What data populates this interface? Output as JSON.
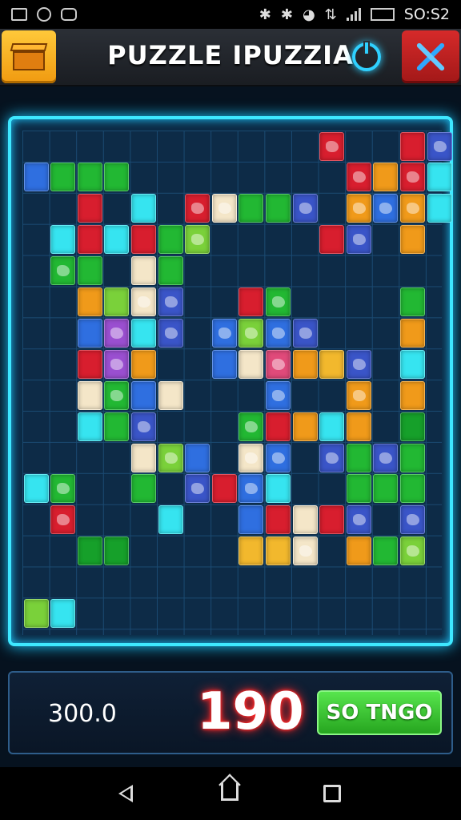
{
  "status_bar": {
    "time": "SO:S2",
    "icons": [
      "image-icon",
      "alarm-icon",
      "game-icon",
      "bluetooth-icon",
      "bluetooth-icon",
      "wifi-icon",
      "data-icon",
      "signal-icon",
      "battery-icon"
    ]
  },
  "header": {
    "title": "PUZZLE IPUZZIA",
    "home_icon": "crate-icon",
    "power_icon": "power-icon",
    "tools_icon": "tools-icon"
  },
  "board": {
    "columns": 16,
    "rows": 16
  },
  "footer": {
    "left_value": "300.0",
    "big_value": "190",
    "go_label": "SO TNGO"
  },
  "nav": {
    "back_icon": "back-icon",
    "home_icon": "home-icon",
    "recent_icon": "recent-apps-icon"
  },
  "colors": {
    "accent": "#3ee8ff",
    "go_button": "#3cc232",
    "home_button": "#f6ad1d",
    "tools_button": "#c42222",
    "big_value_glow": "#ff2a2a"
  }
}
